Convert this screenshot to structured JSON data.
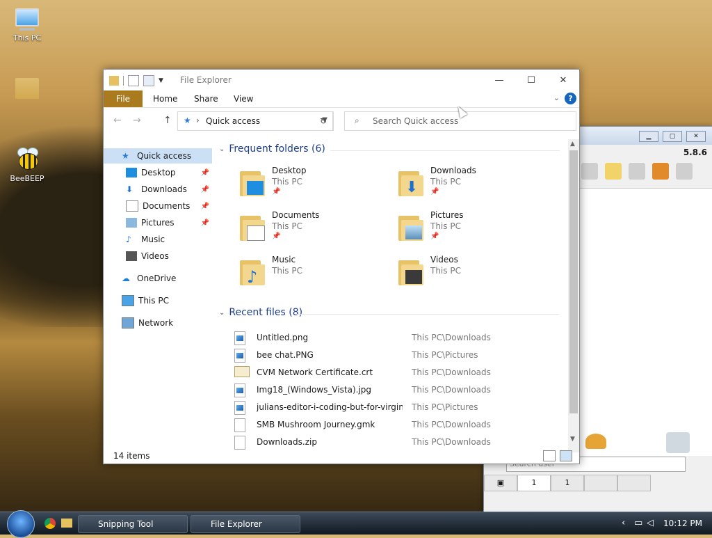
{
  "desktop": {
    "icons": [
      {
        "label": "This PC",
        "icon": "computer-icon"
      },
      {
        "label": "",
        "icon": "folder-icon"
      },
      {
        "label": "BeeBEEP",
        "icon": "bee-icon"
      }
    ]
  },
  "explorer": {
    "title": "File Explorer",
    "ribbon_tabs": [
      "File",
      "Home",
      "Share",
      "View"
    ],
    "address": {
      "location": "Quick access"
    },
    "search": {
      "placeholder": "Search Quick access"
    },
    "sidebar": [
      {
        "label": "Quick access",
        "icon": "star-icon",
        "pinned": false,
        "active": true
      },
      {
        "label": "Desktop",
        "icon": "desktop-icon",
        "pinned": true
      },
      {
        "label": "Downloads",
        "icon": "download-icon",
        "pinned": true
      },
      {
        "label": "Documents",
        "icon": "documents-icon",
        "pinned": true
      },
      {
        "label": "Pictures",
        "icon": "pictures-icon",
        "pinned": true
      },
      {
        "label": "Music",
        "icon": "music-icon",
        "pinned": false
      },
      {
        "label": "Videos",
        "icon": "videos-icon",
        "pinned": false
      },
      {
        "label": "OneDrive",
        "icon": "cloud-icon",
        "pinned": false
      },
      {
        "label": "This PC",
        "icon": "computer-icon",
        "pinned": false
      },
      {
        "label": "Network",
        "icon": "network-icon",
        "pinned": false
      }
    ],
    "frequent": {
      "heading": "Frequent folders (6)",
      "items": [
        {
          "name": "Desktop",
          "location": "This PC",
          "pinned": true
        },
        {
          "name": "Downloads",
          "location": "This PC",
          "pinned": true
        },
        {
          "name": "Documents",
          "location": "This PC",
          "pinned": true
        },
        {
          "name": "Pictures",
          "location": "This PC",
          "pinned": true
        },
        {
          "name": "Music",
          "location": "This PC",
          "pinned": false
        },
        {
          "name": "Videos",
          "location": "This PC",
          "pinned": false
        }
      ]
    },
    "recent": {
      "heading": "Recent files (8)",
      "items": [
        {
          "name": "Untitled.png",
          "path": "This PC\\Downloads",
          "type": "image"
        },
        {
          "name": "bee chat.PNG",
          "path": "This PC\\Pictures",
          "type": "image"
        },
        {
          "name": "CVM Network Certificate.crt",
          "path": "This PC\\Downloads",
          "type": "cert"
        },
        {
          "name": "Img18_(Windows_Vista).jpg",
          "path": "This PC\\Downloads",
          "type": "image"
        },
        {
          "name": "julians-editor-i-coding-but-for-virgin...",
          "path": "This PC\\Pictures",
          "type": "image"
        },
        {
          "name": "SMB Mushroom Journey.gmk",
          "path": "This PC\\Downloads",
          "type": "file"
        },
        {
          "name": "Downloads.zip",
          "path": "This PC\\Downloads",
          "type": "file"
        }
      ]
    },
    "status": {
      "item_count": "14 items"
    }
  },
  "beebeep": {
    "version": "5.8.6",
    "search_placeholder": "Search user",
    "tab_counts": [
      "1",
      "1"
    ]
  },
  "taskbar": {
    "buttons": [
      "Snipping Tool",
      "File Explorer"
    ],
    "clock": "10:12 PM"
  }
}
